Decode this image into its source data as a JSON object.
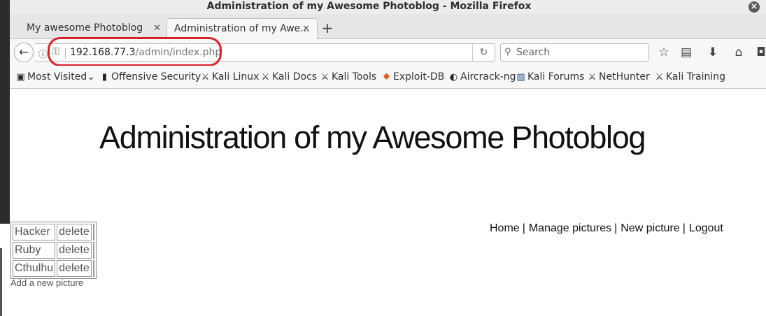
{
  "window": {
    "title": "Administration of my Awesome Photoblog - Mozilla Firefox"
  },
  "tabs": [
    {
      "label": "My awesome Photoblog"
    },
    {
      "label": "Administration of my Awe..."
    }
  ],
  "address": {
    "host": "192.168.77.3",
    "path": "/admin/index.php"
  },
  "search": {
    "placeholder": "Search"
  },
  "bookmarks": [
    {
      "label": "Most Visited",
      "icon": "folder-icon"
    },
    {
      "label": "Offensive Security",
      "icon": "offsec-icon"
    },
    {
      "label": "Kali Linux",
      "icon": "kali-icon"
    },
    {
      "label": "Kali Docs",
      "icon": "kali-icon"
    },
    {
      "label": "Kali Tools",
      "icon": "kali-icon"
    },
    {
      "label": "Exploit-DB",
      "icon": "exploitdb-icon"
    },
    {
      "label": "Aircrack-ng",
      "icon": "aircrack-icon"
    },
    {
      "label": "Kali Forums",
      "icon": "forum-icon"
    },
    {
      "label": "NetHunter",
      "icon": "kali-icon"
    },
    {
      "label": "Kali Training",
      "icon": "kali-icon"
    }
  ],
  "page": {
    "heading": "Administration of my Awesome Photoblog",
    "menu": [
      "Home",
      "Manage pictures",
      "New picture",
      "Logout"
    ],
    "pictures": [
      {
        "name": "Hacker",
        "action": "delete"
      },
      {
        "name": "Ruby",
        "action": "delete"
      },
      {
        "name": "Cthulhu",
        "action": "delete"
      }
    ],
    "add_link": "Add a new picture"
  },
  "colors": {
    "highlight": "#d8232e"
  }
}
